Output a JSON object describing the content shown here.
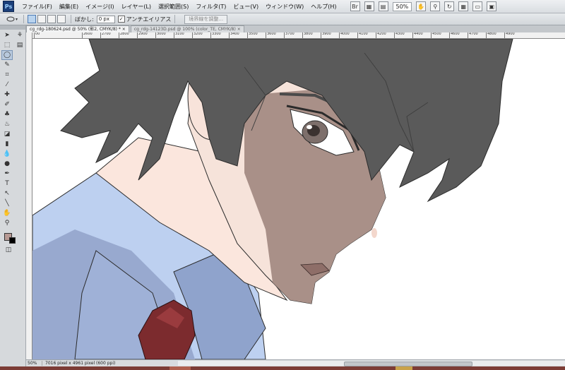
{
  "app": {
    "logo": "Ps",
    "accent": "#1b3f7a"
  },
  "menubar": {
    "items": [
      "ファイル(F)",
      "編集(E)",
      "イメージ(I)",
      "レイヤー(L)",
      "選択範囲(S)",
      "フィルタ(T)",
      "ビュー(V)",
      "ウィンドウ(W)",
      "ヘルプ(H)"
    ],
    "zoom": "50%",
    "icons": [
      "bridge-icon",
      "minibridge-icon",
      "view-extras-icon",
      "zoom-level-select",
      "hand-icon",
      "zoom-icon",
      "rotate-view-icon",
      "grid-icon",
      "arrange-docs-icon",
      "screen-mode-icon"
    ]
  },
  "options": {
    "feather_label": "ぼかし:",
    "feather_value": "0 px",
    "antialias_label": "アンチエイリアス",
    "antialias_checked": true,
    "refine_button": "境界線を調整..."
  },
  "tabs": [
    {
      "label": "cg_rdg-180624.psd @ 50% (影2, CMYK/8) *",
      "active": true
    },
    {
      "label": "cg_rdg-14123D.psd @ 100% (color_TE, CMYK/8)",
      "active": false
    }
  ],
  "ruler": {
    "labels": [
      "00",
      "2600",
      "2700",
      "2800",
      "2900",
      "3000",
      "3100",
      "3200",
      "3300",
      "3400",
      "3500",
      "3600",
      "3700",
      "3800",
      "3900",
      "4000",
      "4100",
      "4200",
      "4300",
      "4400",
      "4500",
      "4600",
      "4700",
      "4800",
      "4900"
    ]
  },
  "status": {
    "zoom": "50%",
    "info": "7016 pixel x 4961 pixel (600 ppi)"
  },
  "colors": {
    "foreground": "#b89a94",
    "background": "#ffffff",
    "hair": "#5a5a5a",
    "skin": "#f7e4dc",
    "shirt": "#c8d7f2",
    "tie": "#7c2b2e"
  }
}
